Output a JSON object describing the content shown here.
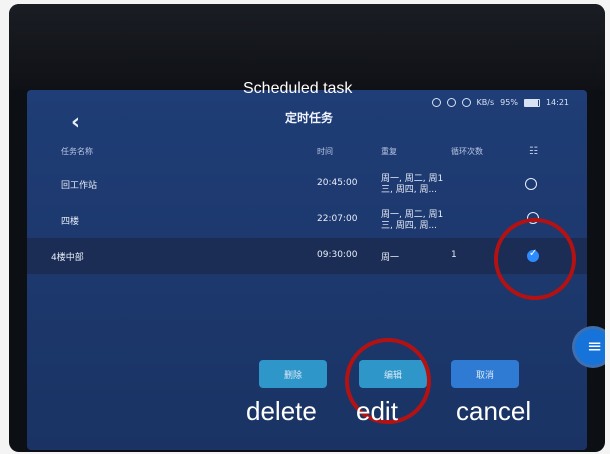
{
  "annotation": {
    "title": "Scheduled task",
    "captions": {
      "delete": "delete",
      "edit": "edit",
      "cancel": "cancel"
    }
  },
  "status_bar": {
    "battery_percent": "95%",
    "time": "14:21",
    "network": "KB/s"
  },
  "page": {
    "title": "定时任务",
    "back_icon": "back-chevron-icon"
  },
  "table": {
    "headers": {
      "name": "任务名称",
      "time": "时间",
      "repeat": "重复",
      "loops": "循环次数",
      "select": "select-list-icon"
    },
    "rows": [
      {
        "name": "回工作站",
        "time": "20:45:00",
        "repeat": "周一, 周二, 周1\n三, 周四, 周...",
        "loops": "",
        "selected": false
      },
      {
        "name": "四楼",
        "time": "22:07:00",
        "repeat": "周一, 周二, 周1\n三, 周四, 周...",
        "loops": "",
        "selected": false
      },
      {
        "name": "4楼中部",
        "time": "09:30:00",
        "repeat": "周一",
        "loops": "1",
        "selected": true
      }
    ]
  },
  "actions": {
    "delete": "删除",
    "edit": "编辑",
    "cancel": "取消"
  },
  "colors": {
    "screen_bg": "#1f3d76",
    "button_bg": "#2f96c9",
    "check_blue": "#2d8cff",
    "annotation_red": "#b41212"
  }
}
